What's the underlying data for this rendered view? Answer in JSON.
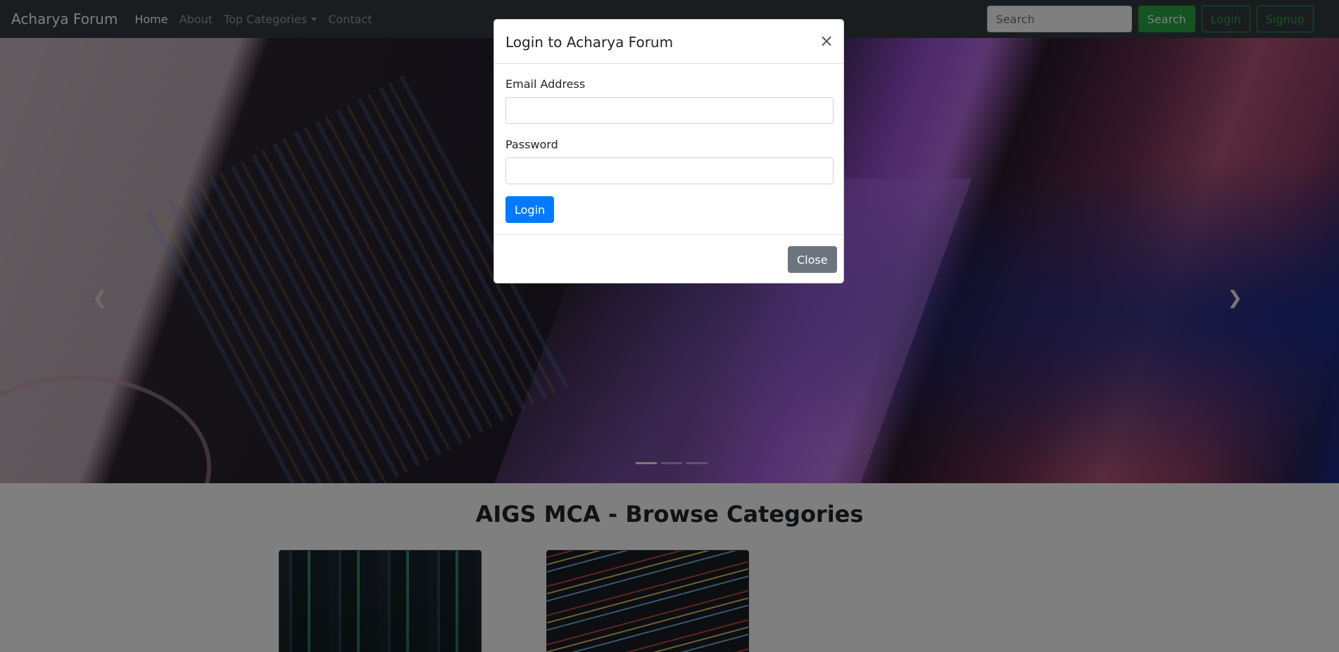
{
  "navbar": {
    "brand": "Acharya Forum",
    "links": [
      {
        "label": "Home",
        "active": true
      },
      {
        "label": "About",
        "active": false
      },
      {
        "label": "Top Categories",
        "active": false,
        "dropdown": true
      },
      {
        "label": "Contact",
        "active": false
      }
    ],
    "search_placeholder": "Search",
    "search_button": "Search",
    "login_button": "Login",
    "signup_button": "Signup"
  },
  "carousel": {
    "prev_icon": "chevron-left-icon",
    "next_icon": "chevron-right-icon",
    "slide_count": 3,
    "active_slide": 1
  },
  "main": {
    "title": "AIGS MCA - Browse Categories"
  },
  "modal": {
    "title": "Login to Acharya Forum",
    "close_icon": "close-icon",
    "email_label": "Email Address",
    "email_value": "",
    "password_label": "Password",
    "password_value": "",
    "login_button": "Login",
    "close_button": "Close"
  },
  "colors": {
    "navbar_bg": "#343a40",
    "success": "#28a745",
    "primary": "#007bff",
    "secondary": "#6c757d"
  }
}
